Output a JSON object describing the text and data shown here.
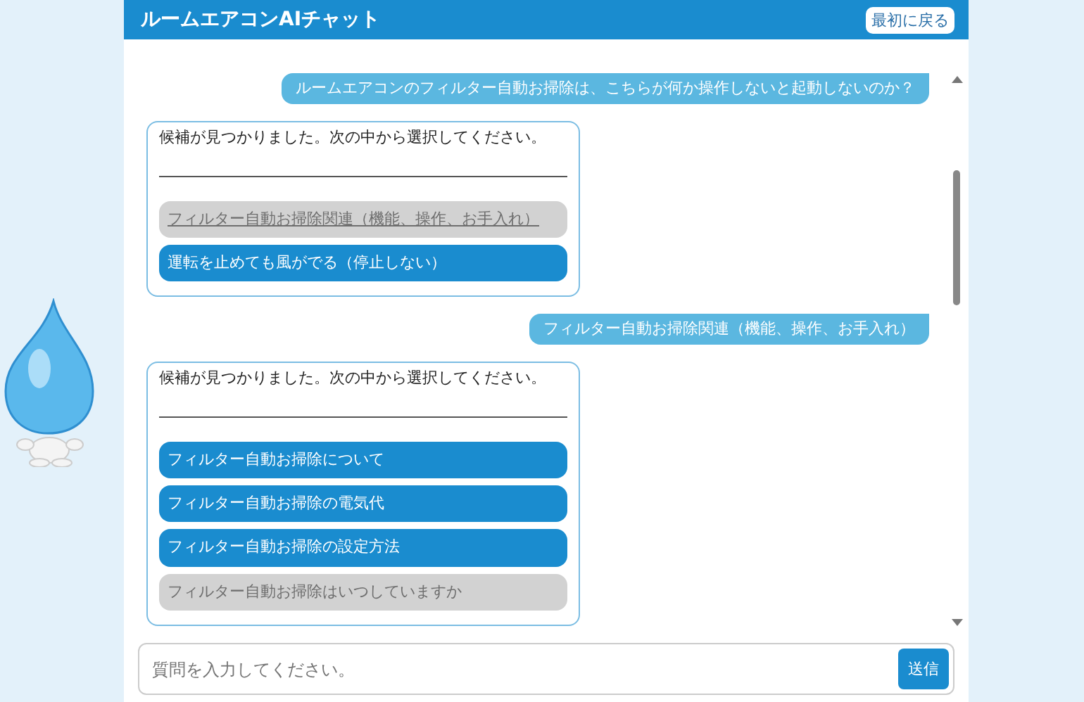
{
  "header": {
    "title": "ルームエアコンAIチャット",
    "back_button": "最初に戻る"
  },
  "messages": [
    {
      "kind": "user",
      "text": "ルームエアコンのフィルター自動お掃除は、こちらが何か操作しないと起動しないのか？"
    },
    {
      "kind": "bot",
      "text": "候補が見つかりました。次の中から選択してください。",
      "options": [
        {
          "label": "フィルター自動お掃除関連（機能、操作、お手入れ）",
          "disabled": true,
          "selected": true
        },
        {
          "label": "運転を止めても風がでる（停止しない）",
          "disabled": false,
          "selected": false
        }
      ]
    },
    {
      "kind": "user",
      "text": "フィルター自動お掃除関連（機能、操作、お手入れ）"
    },
    {
      "kind": "bot",
      "text": "候補が見つかりました。次の中から選択してください。",
      "options": [
        {
          "label": "フィルター自動お掃除について",
          "disabled": false,
          "selected": false
        },
        {
          "label": "フィルター自動お掃除の電気代",
          "disabled": false,
          "selected": false
        },
        {
          "label": "フィルター自動お掃除の設定方法",
          "disabled": false,
          "selected": false
        },
        {
          "label": "フィルター自動お掃除はいつしていますか",
          "disabled": true,
          "selected": false
        }
      ]
    }
  ],
  "input": {
    "placeholder": "質問を入力してください。",
    "send_button": "送信"
  }
}
